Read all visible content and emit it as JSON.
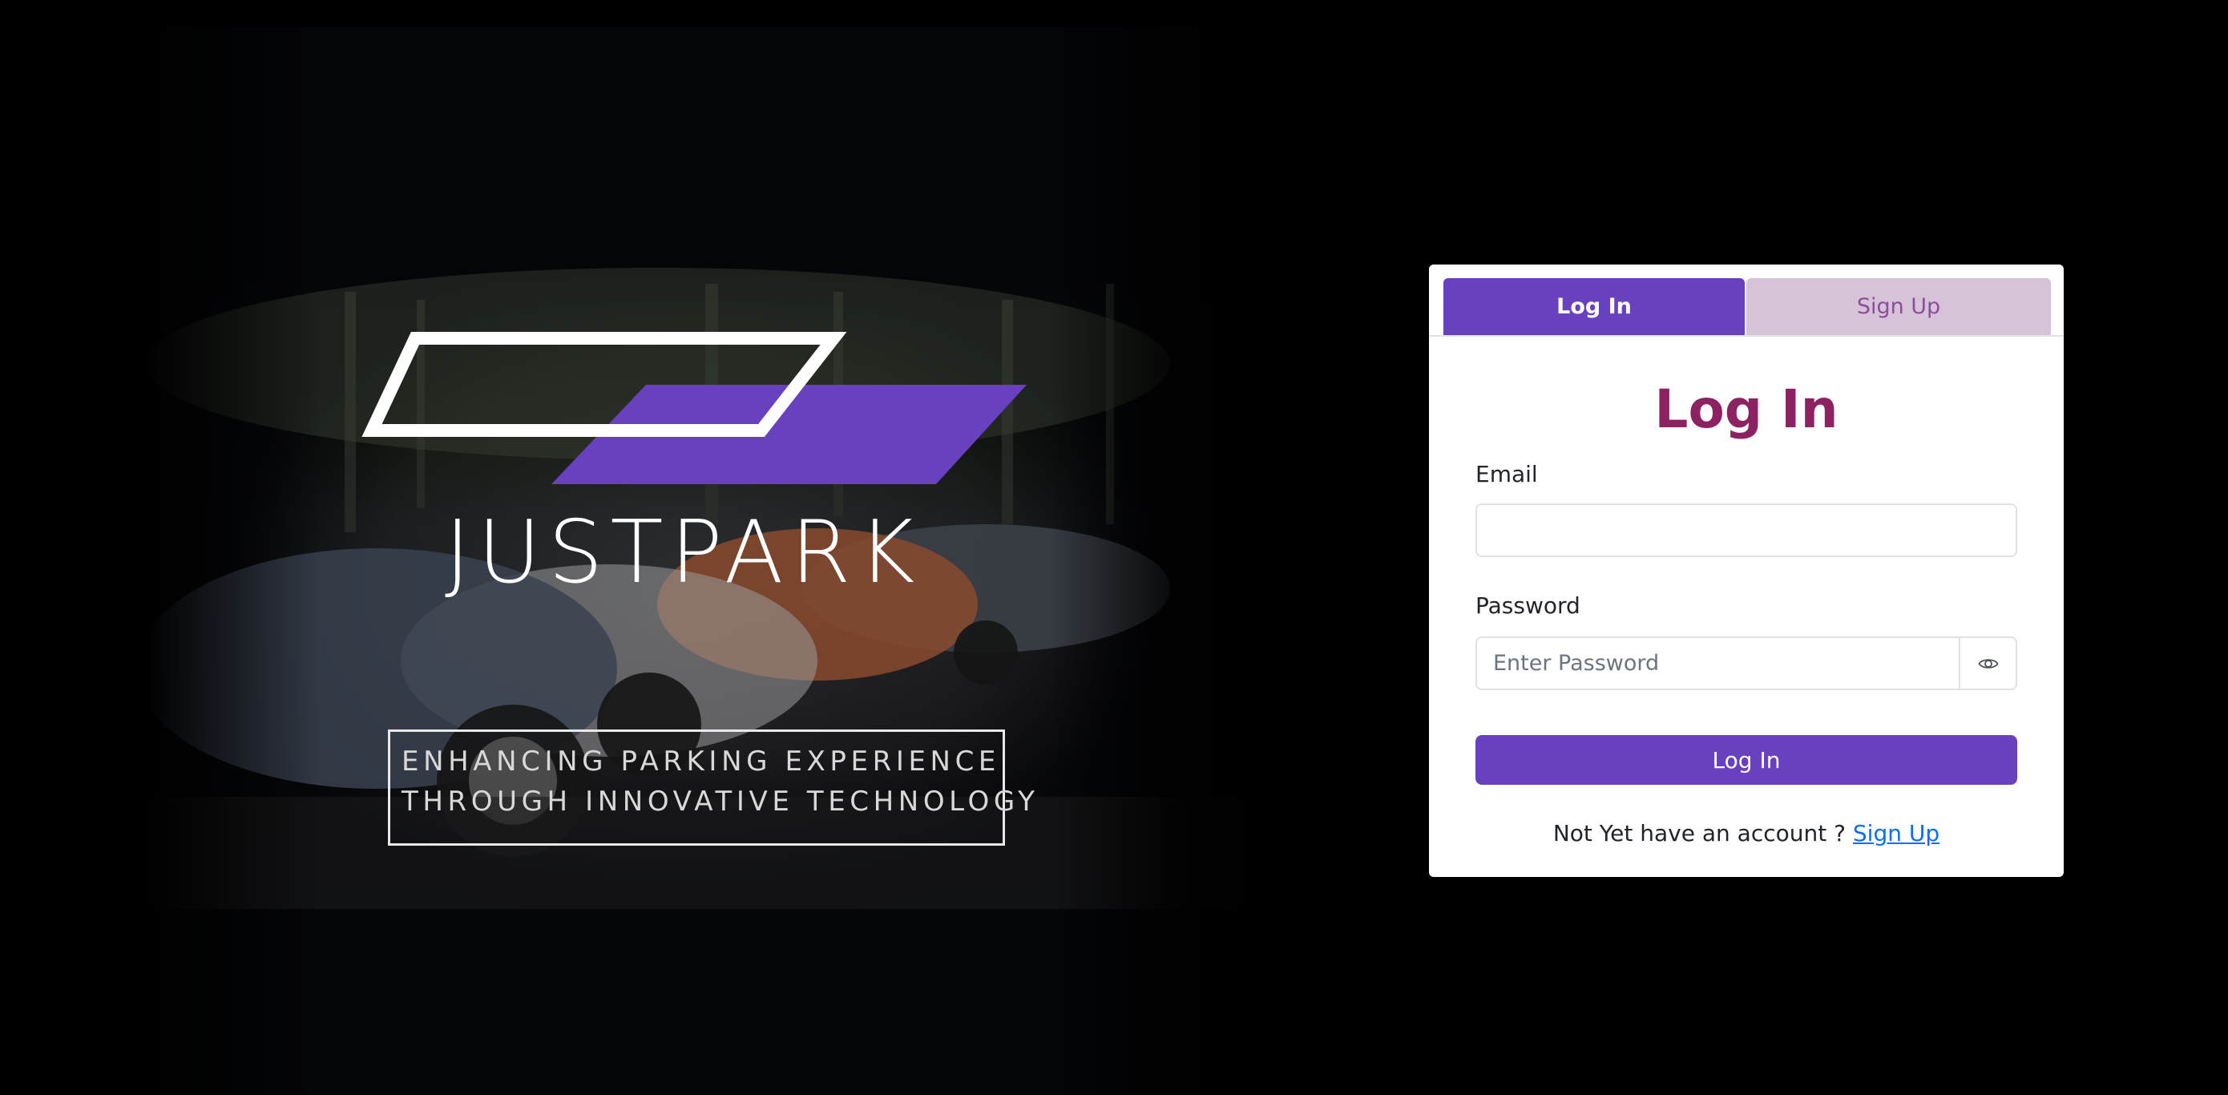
{
  "brand": {
    "name": "JUSTPARK",
    "tagline_lines": [
      "ENHANCING PARKING EXPERIENCE",
      "THROUGH INNOVATIVE TECHNOLOGY"
    ],
    "logo_icon": "parking-parallelogram-logo"
  },
  "auth": {
    "tabs": [
      {
        "label": "Log In",
        "active": true
      },
      {
        "label": "Sign Up",
        "active": false
      }
    ],
    "title": "Log In",
    "email": {
      "label": "Email",
      "value": "",
      "placeholder": ""
    },
    "password": {
      "label": "Password",
      "value": "",
      "placeholder": "Enter Password",
      "toggle_icon": "eye-icon"
    },
    "submit_label": "Log In",
    "footer": {
      "prompt": "Not Yet have an account ?",
      "link_label": "Sign Up"
    }
  },
  "colors": {
    "accent": "#6741bf",
    "title": "#8c2262",
    "inactive_tab": "#d7c3d8",
    "inactive_tab_text": "#8a4f9b",
    "link": "#0d6efd",
    "page_background": "#000000"
  }
}
